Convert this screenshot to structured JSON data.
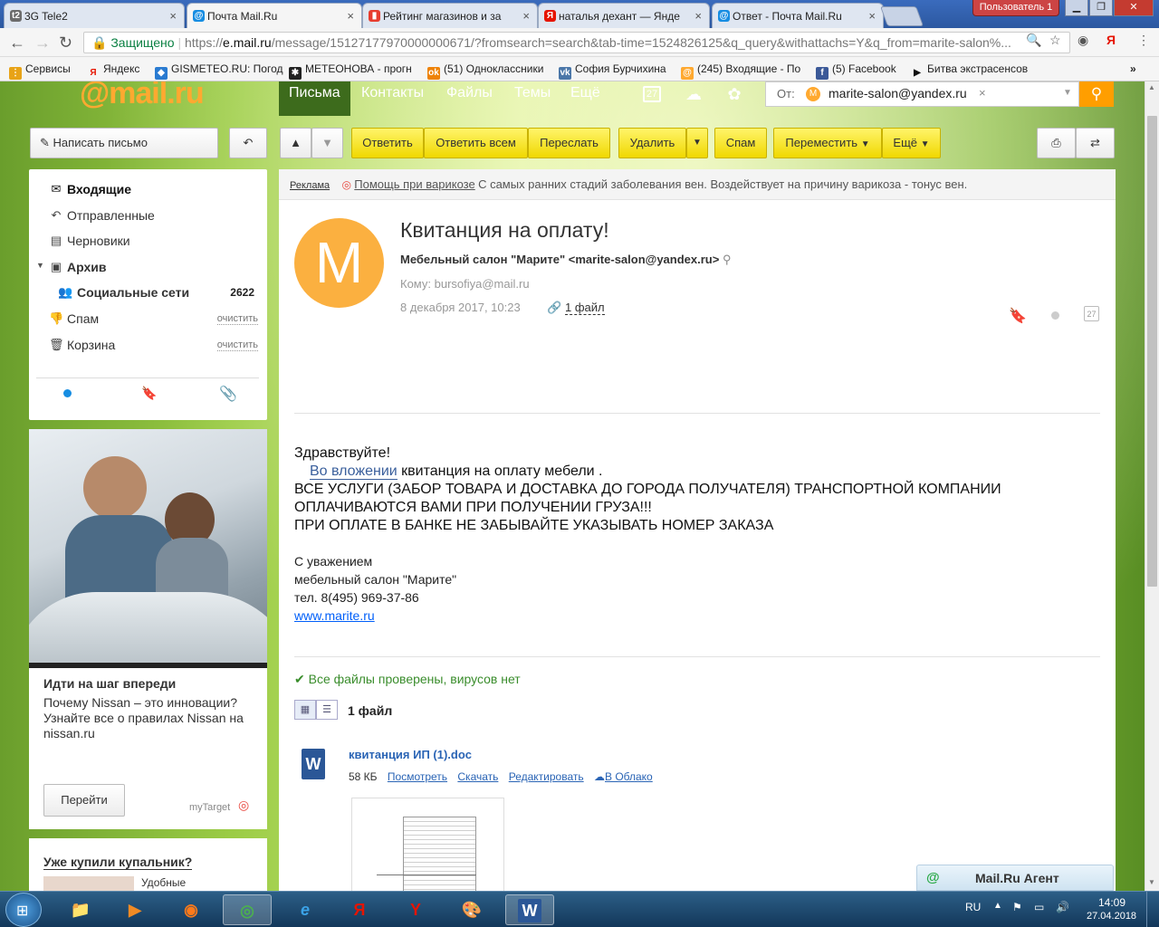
{
  "browser": {
    "tabs": [
      {
        "title": "3G Tele2",
        "icon": "tele2-icon",
        "color": "#6c6c6c",
        "glyph": "t2"
      },
      {
        "title": "Почта Mail.Ru",
        "icon": "mailru-icon",
        "color": "#168de2",
        "glyph": "@"
      },
      {
        "title": "Рейтинг магазинов и за",
        "icon": "chart-icon",
        "color": "#e73d2f",
        "glyph": "▮"
      },
      {
        "title": "наталья дехант — Янде",
        "icon": "yandex-icon",
        "color": "#e61400",
        "glyph": "Я"
      },
      {
        "title": "Ответ - Почта Mail.Ru",
        "icon": "mailru-icon",
        "color": "#168de2",
        "glyph": "@"
      }
    ],
    "user_badge": "Пользователь 1",
    "address": {
      "secure_label": "Защищено",
      "url_scheme": "https://",
      "url_host": "e.mail.ru",
      "url_rest": "/message/15127177970000000671/?fromsearch=search&tab-time=1524826125&q_query&withattachs=Y&q_from=marite-salon%..."
    },
    "bookmarks": [
      {
        "label": "Сервисы",
        "icon": "apps-icon",
        "color": "#e8a317",
        "glyph": "⋮"
      },
      {
        "label": "Яндекс",
        "icon": "yandex-icon",
        "color": "#e61400",
        "glyph": "Я"
      },
      {
        "label": "GISMETEO.RU: Погод",
        "icon": "gismeteo-icon",
        "color": "#2a7bd1",
        "glyph": "◆"
      },
      {
        "label": "МЕТЕОНОВА - прогн",
        "icon": "meteonova-icon",
        "color": "#222",
        "glyph": "✱"
      },
      {
        "label": "(51) Одноклассники",
        "icon": "ok-icon",
        "color": "#ee8208",
        "glyph": "ok"
      },
      {
        "label": "София Бурчихина",
        "icon": "vk-icon",
        "color": "#4a76a8",
        "glyph": "vk"
      },
      {
        "label": "(245) Входящие - По",
        "icon": "mailru-icon",
        "color": "#ffa930",
        "glyph": "@"
      },
      {
        "label": "(5) Facebook",
        "icon": "facebook-icon",
        "color": "#3b5998",
        "glyph": "f"
      },
      {
        "label": "Битва экстрасенсов",
        "icon": "play-icon",
        "color": "#111",
        "glyph": "▶"
      }
    ]
  },
  "mail": {
    "logo_at": "@",
    "logo_text": "mail.ru",
    "nav": [
      "Письма",
      "Контакты",
      "Файлы",
      "Темы",
      "Ещё"
    ],
    "calendar_day": "27",
    "search": {
      "label": "От:",
      "chip": "marite-salon@yandex.ru",
      "chip_initial": "M"
    },
    "compose": "Написать письмо",
    "actions": {
      "reply": "Ответить",
      "reply_all": "Ответить всем",
      "forward": "Переслать",
      "delete": "Удалить",
      "spam": "Спам",
      "move": "Переместить",
      "more": "Ещё"
    },
    "folders": [
      {
        "label": "Входящие",
        "icon": "inbox-icon",
        "glyph": "✉",
        "bold": true
      },
      {
        "label": "Отправленные",
        "icon": "sent-icon",
        "glyph": "↶"
      },
      {
        "label": "Черновики",
        "icon": "drafts-icon",
        "glyph": "▤"
      },
      {
        "label": "Архив",
        "icon": "archive-icon",
        "glyph": "▣",
        "bold": true
      },
      {
        "label": "Социальные сети",
        "icon": "social-icon",
        "glyph": "👥",
        "count": "2622",
        "bold": true
      },
      {
        "label": "Спам",
        "icon": "spam-icon",
        "glyph": "👎",
        "clean": "очистить"
      },
      {
        "label": "Корзина",
        "icon": "trash-icon",
        "glyph": "🗑",
        "clean": "очистить"
      }
    ],
    "ad": {
      "title": "Идти на шаг впереди",
      "text1": "Почему Nissan – это инновации?",
      "text2": "Узнайте все о правилах Nissan на",
      "text3": "nissan.ru",
      "button": "Перейти",
      "brand": "myTarget"
    },
    "ad2": {
      "title": "Уже купили купальник?",
      "text": "Удобные"
    },
    "adline": {
      "label": "Реклама",
      "link": "Помощь при варикозе",
      "text": "С самых ранних стадий заболевания вен. Воздействует на причину варикоза - тонус вен."
    },
    "message": {
      "avatar_letter": "M",
      "subject": "Квитанция на оплату!",
      "from": "Мебельный салон \"Марите\" <marite-salon@yandex.ru>",
      "to": "Кому: bursofiya@mail.ru",
      "date": "8 декабря 2017, 10:23",
      "files": "1 файл",
      "calendar_day": "27",
      "greeting": "Здравствуйте!",
      "attach_link": "Во вложении",
      "line1_rest": " квитанция на оплату мебели .",
      "line2": "ВСЕ УСЛУГИ (ЗАБОР ТОВАРА И ДОСТАВКА ДО ГОРОДА ПОЛУЧАТЕЛЯ) ТРАНСПОРТНОЙ КОМПАНИИ",
      "line3": "ОПЛАЧИВАЮТСЯ ВАМИ ПРИ ПОЛУЧЕНИИ ГРУЗА!!!",
      "line4": "ПРИ ОПЛАТЕ В БАНКЕ НЕ ЗАБЫВАЙТЕ УКАЗЫВАТЬ НОМЕР ЗАКАЗА",
      "sign1": "С уважением",
      "sign2": "мебельный салон \"Марите\"",
      "sign3": "тел. 8(495) 969-37-86",
      "site": "www.marite.ru"
    },
    "attachments": {
      "scan_ok": "Все файлы проверены, вирусов нет",
      "count": "1 файл",
      "file": {
        "name": "квитанция ИП (1).doc",
        "size": "58 КБ",
        "view": "Посмотреть",
        "download": "Скачать",
        "edit": "Редактировать",
        "cloud": "В Облако"
      }
    },
    "agent": "Mail.Ru Агент"
  },
  "taskbar": {
    "lang": "RU",
    "time": "14:09",
    "date": "27.04.2018",
    "apps": [
      {
        "icon": "explorer-icon",
        "glyph": "📁",
        "color": "#f0c040"
      },
      {
        "icon": "media-player-icon",
        "glyph": "▶",
        "color": "#f08a24"
      },
      {
        "icon": "firefox-icon",
        "glyph": "◉",
        "color": "#ff7a1a"
      },
      {
        "icon": "chrome-icon",
        "glyph": "◎",
        "color": "#4caf50",
        "active": true
      },
      {
        "icon": "ie-icon",
        "glyph": "e",
        "color": "#3ba3e8"
      },
      {
        "icon": "yandex-browser-icon",
        "glyph": "Я",
        "color": "#e61400"
      },
      {
        "icon": "yandex-icon",
        "glyph": "Y",
        "color": "#e61400"
      },
      {
        "icon": "paint-icon",
        "glyph": "🎨",
        "color": "#ccc"
      },
      {
        "icon": "word-icon",
        "glyph": "W",
        "color": "#2b5797",
        "active": true
      }
    ]
  }
}
